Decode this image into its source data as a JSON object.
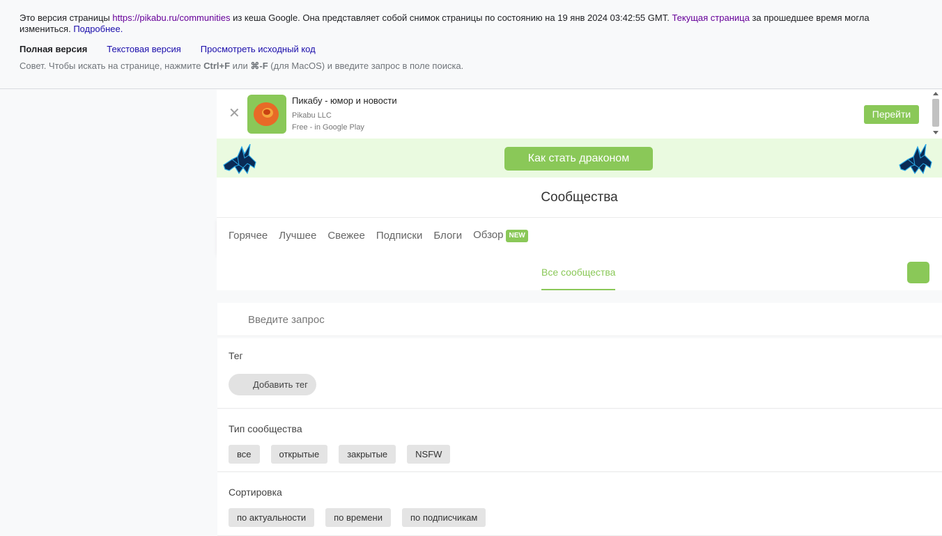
{
  "cache_banner": {
    "prefix": "Это версия страницы ",
    "url": "https://pikabu.ru/communities",
    "mid": " из кеша Google. Она представляет собой снимок страницы по состоянию на 19 янв 2024 03:42:55 GMT. ",
    "current_link": "Текущая страница",
    "suffix": " за прошедшее время могла измениться. ",
    "more_link": "Подробнее.",
    "full_version": "Полная версия",
    "text_version": "Текстовая версия",
    "view_source": "Просмотреть исходный код",
    "tip_prefix": "Совет. Чтобы искать на странице, нажмите ",
    "tip_key1": "Ctrl+F",
    "tip_or": " или ",
    "tip_key2": "⌘-F",
    "tip_suffix": " (для MacOS) и введите запрос в поле поиска."
  },
  "app_banner": {
    "close": "✕",
    "title": "Пикабу - юмор и новости",
    "publisher": "Pikabu LLC",
    "store": "Free - in Google Play",
    "button": "Перейти"
  },
  "dragon": {
    "button": "Как стать драконом"
  },
  "page_title": "Сообщества",
  "nav": {
    "items": [
      "Горячее",
      "Лучшее",
      "Свежее",
      "Подписки",
      "Блоги",
      "Обзор"
    ],
    "badge": "NEW"
  },
  "subtabs": {
    "active": "Все сообщества"
  },
  "search": {
    "placeholder": "Введите запрос"
  },
  "tag_section": {
    "label": "Тег",
    "button": "Добавить тег"
  },
  "type_section": {
    "label": "Тип сообщества",
    "options": [
      "все",
      "открытые",
      "закрытые",
      "NSFW"
    ]
  },
  "sort_section": {
    "label": "Сортировка",
    "options": [
      "по актуальности",
      "по времени",
      "по подписчикам"
    ]
  },
  "colors": {
    "accent": "#8ac858",
    "dragon_bg": "#eafae0",
    "link": "#1a0dab"
  }
}
